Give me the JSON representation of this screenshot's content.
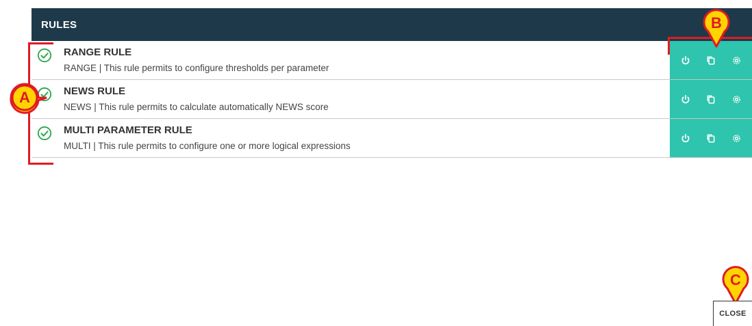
{
  "header": {
    "title": "RULES"
  },
  "rules": [
    {
      "title": "RANGE RULE",
      "description": "RANGE | This rule permits to configure thresholds per parameter"
    },
    {
      "title": "NEWS RULE",
      "description": "NEWS | This rule permits to calculate automatically NEWS score"
    },
    {
      "title": "MULTI PARAMETER RULE",
      "description": "MULTI | This rule permits to configure one or more logical expressions"
    }
  ],
  "actions": [
    "power-icon",
    "copy-icon",
    "gear-icon"
  ],
  "footer": {
    "close_label": "CLOSE"
  },
  "callouts": {
    "a": "A",
    "b": "B",
    "c": "C"
  },
  "colors": {
    "header_bg": "#1e3a4a",
    "action_bg": "#2ec4ad",
    "check": "#2aa84a",
    "callout_fill": "#ffd400",
    "callout_stroke": "#e01a24"
  }
}
